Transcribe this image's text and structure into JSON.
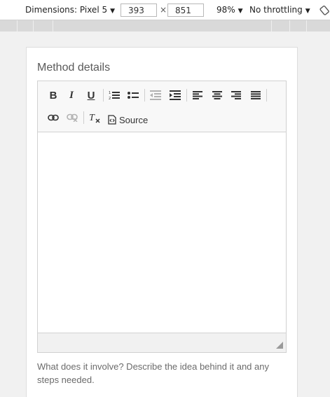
{
  "devtools": {
    "device_label": "Dimensions: Pixel 5",
    "width_value": "393",
    "height_value": "851",
    "times": "×",
    "zoom_label": "98%",
    "throttle_label": "No throttling",
    "caret": "▼"
  },
  "form": {
    "field_label": "Method details",
    "help_text": "What does it involve? Describe the idea behind it and any steps needed."
  },
  "editor": {
    "toolbar": {
      "bold": "B",
      "italic": "I",
      "underline": "U",
      "source_label": "Source"
    },
    "icons": {
      "bold": "bold-icon",
      "italic": "italic-icon",
      "underline": "underline-icon",
      "numbered_list": "numbered-list-icon",
      "bulleted_list": "bulleted-list-icon",
      "outdent": "outdent-icon",
      "indent": "indent-icon",
      "align_left": "align-left-icon",
      "align_center": "align-center-icon",
      "align_right": "align-right-icon",
      "justify": "justify-icon",
      "link": "link-icon",
      "unlink": "unlink-icon",
      "remove_format": "remove-format-icon",
      "source": "source-icon",
      "resize": "resize-grip-icon"
    }
  }
}
